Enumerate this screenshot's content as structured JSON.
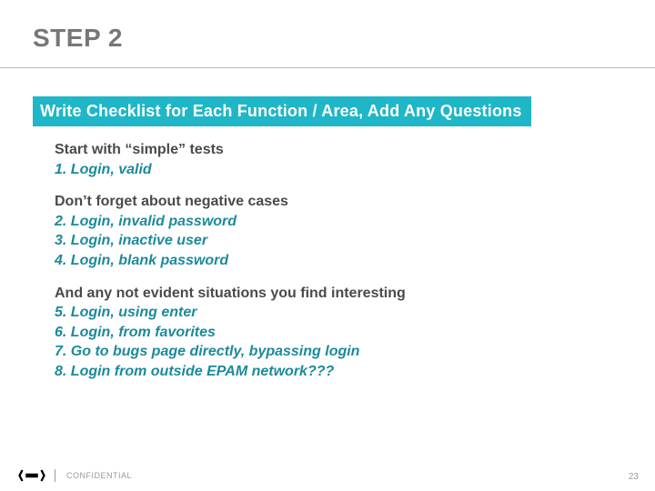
{
  "title": "STEP 2",
  "banner": "Write Checklist for Each Function / Area, Add Any Questions",
  "sections": [
    {
      "heading": "Start with “simple” tests",
      "items": [
        "1. Login, valid"
      ]
    },
    {
      "heading": "Don’t forget about negative cases",
      "items": [
        "2. Login, invalid password",
        "3. Login, inactive user",
        "4. Login, blank password"
      ]
    },
    {
      "heading": "And any not evident situations you find interesting",
      "items": [
        "5. Login, using enter",
        "6. Login, from favorites",
        "7. Go to bugs page directly, bypassing login",
        "8. Login from outside EPAM network???"
      ]
    }
  ],
  "footer": {
    "confidential": "CONFIDENTIAL",
    "page_number": "23"
  }
}
